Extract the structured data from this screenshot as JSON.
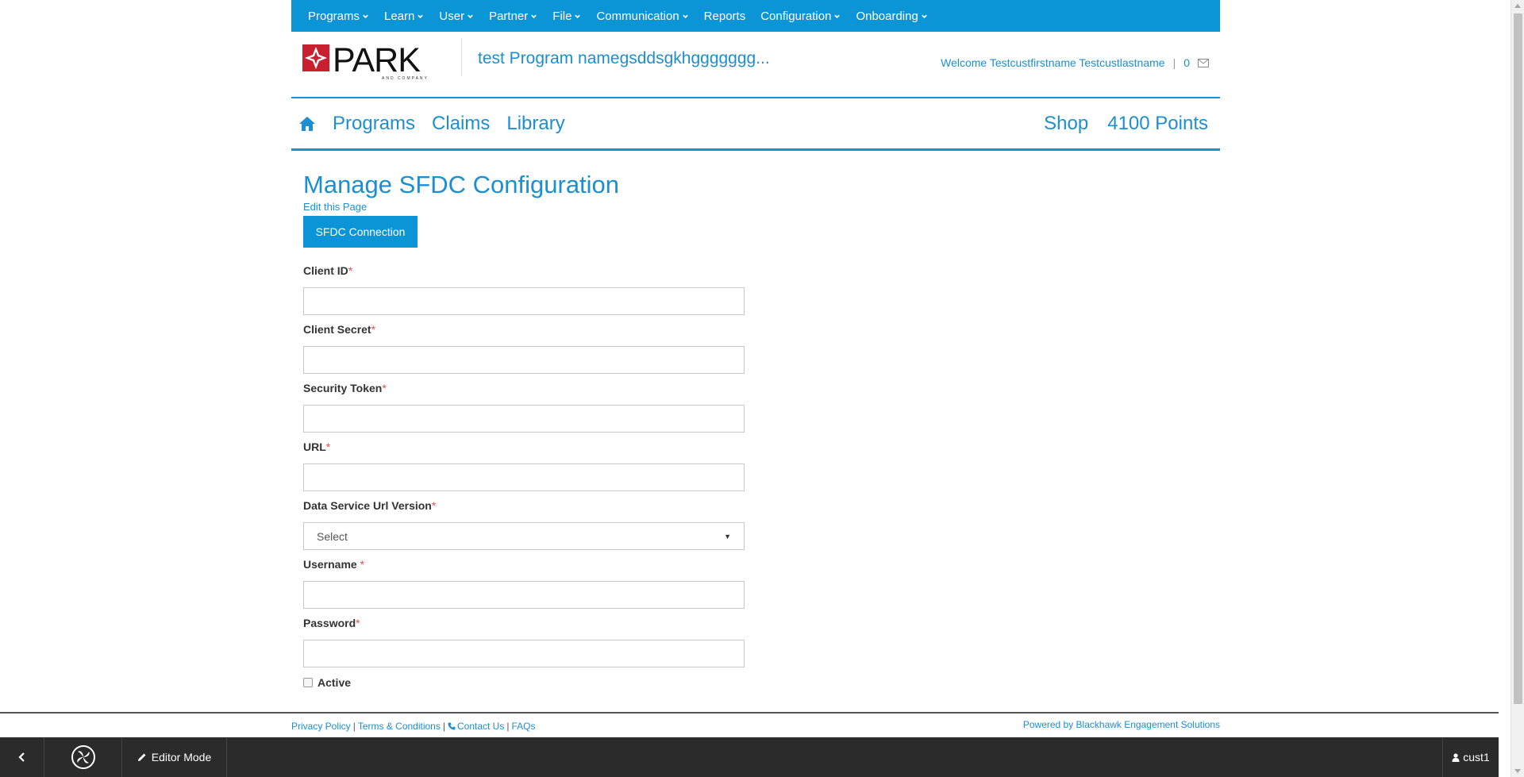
{
  "admin_menu": {
    "items": [
      {
        "label": "Programs",
        "dropdown": true
      },
      {
        "label": "Learn",
        "dropdown": true
      },
      {
        "label": "User",
        "dropdown": true
      },
      {
        "label": "Partner",
        "dropdown": true
      },
      {
        "label": "File",
        "dropdown": true
      },
      {
        "label": "Communication",
        "dropdown": true
      },
      {
        "label": "Reports",
        "dropdown": false
      },
      {
        "label": "Configuration",
        "dropdown": true
      },
      {
        "label": "Onboarding",
        "dropdown": true
      }
    ]
  },
  "header": {
    "logo_text": "PARK",
    "logo_subtext": "AND COMPANY",
    "program_name": "test Program namegsddsgkhggggggg...",
    "welcome_text": "Welcome Testcustfirstname Testcustlastname",
    "message_count": "0"
  },
  "main_nav": {
    "left": [
      "Programs",
      "Claims",
      "Library"
    ],
    "shop_label": "Shop",
    "points_label": "4100 Points"
  },
  "page": {
    "title": "Manage SFDC Configuration",
    "edit_link": "Edit this Page",
    "connection_button": "SFDC Connection"
  },
  "form": {
    "required_marker": "*",
    "client_id": {
      "label": "Client ID",
      "value": ""
    },
    "client_secret": {
      "label": "Client Secret",
      "value": ""
    },
    "security_token": {
      "label": "Security Token",
      "value": ""
    },
    "url": {
      "label": "URL",
      "value": ""
    },
    "data_service_url_version": {
      "label": "Data Service Url Version",
      "selected": "Select"
    },
    "username": {
      "label": "Username ",
      "value": ""
    },
    "password": {
      "label": "Password",
      "value": ""
    },
    "active": {
      "label": "Active",
      "checked": false
    }
  },
  "footer": {
    "privacy": "Privacy Policy",
    "terms": "Terms & Conditions",
    "contact": "Contact Us",
    "faqs": "FAQs",
    "separator": "|",
    "powered_by": "Powered by Blackhawk Engagement Solutions"
  },
  "bottom_bar": {
    "editor_mode": "Editor Mode",
    "user": "cust1"
  },
  "colors": {
    "accent": "#1b8fd1",
    "admin_bar": "#0b95d6",
    "required": "#d9534f",
    "bottom_bar": "#2b2b2b"
  }
}
